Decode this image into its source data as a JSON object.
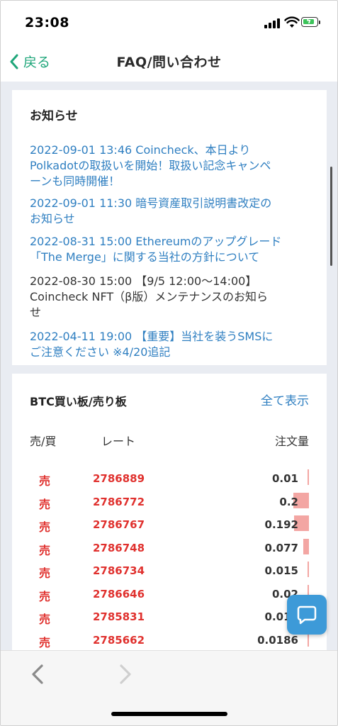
{
  "status_bar": {
    "time": "23:08"
  },
  "nav": {
    "back_label": "戻る",
    "title": "FAQ/問い合わせ"
  },
  "news": {
    "heading": "お知らせ",
    "items": [
      {
        "lines": [
          "2022-09-01 13:46 Coincheck、本日より",
          "Polkadotの取扱いを開始！取扱い記念キャンペ",
          "ーンも同時開催！"
        ]
      },
      {
        "lines": [
          "2022-09-01 11:30 暗号資産取引説明書改定の",
          "お知らせ"
        ]
      },
      {
        "lines": [
          "2022-08-31 15:00 Ethereumのアップグレード",
          "「The Merge」に関する当社の方針について"
        ]
      },
      {
        "lines": [
          "2022-08-30 15:00 【9/5 12:00〜14:00】",
          "Coincheck NFT（β版）メンテナンスのお知ら",
          "せ"
        ]
      },
      {
        "lines": [
          "2022-04-11 19:00 【重要】当社を装うSMSに",
          "ご注意ください ※4/20追記"
        ]
      }
    ]
  },
  "orderbook": {
    "heading": "BTC買い板/売り板",
    "show_all": "全て表示",
    "columns": {
      "side": "売/買",
      "rate": "レート",
      "amount": "注文量"
    },
    "rows": [
      {
        "side": "売",
        "rate": "2786889",
        "amount": "0.01",
        "depth": 0.05
      },
      {
        "side": "売",
        "rate": "2786772",
        "amount": "0.2",
        "depth": 1.0
      },
      {
        "side": "売",
        "rate": "2786767",
        "amount": "0.192",
        "depth": 0.96
      },
      {
        "side": "売",
        "rate": "2786748",
        "amount": "0.077",
        "depth": 0.38
      },
      {
        "side": "売",
        "rate": "2786734",
        "amount": "0.015",
        "depth": 0.07
      },
      {
        "side": "売",
        "rate": "2786646",
        "amount": "0.02",
        "depth": 0.1
      },
      {
        "side": "売",
        "rate": "2785831",
        "amount": "0.018",
        "depth": 0.09
      },
      {
        "side": "売",
        "rate": "2785662",
        "amount": "0.0186",
        "depth": 0.09
      }
    ]
  },
  "colors": {
    "accent_green": "#1fa67a",
    "link_blue": "#2f7fc1",
    "sell_red": "#e0312e",
    "depth_bar": "#f3a6a3",
    "chat_blue": "#3d9ad8"
  },
  "icons": {
    "back": "chevron-left-icon",
    "chat": "chat-bubble-icon",
    "prev": "chevron-left-icon",
    "next": "chevron-right-icon"
  }
}
